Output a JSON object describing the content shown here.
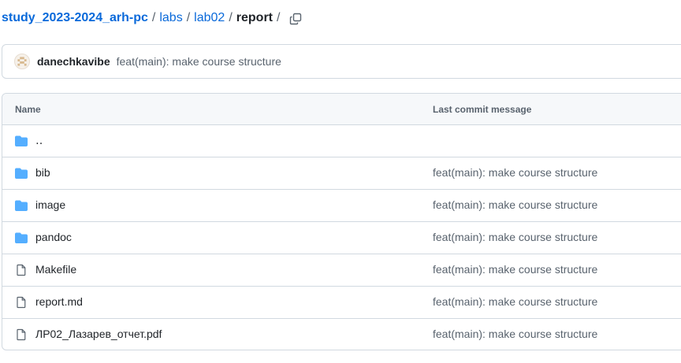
{
  "breadcrumb": {
    "repo": "study_2023-2024_arh-pc",
    "sep1": "/",
    "dir1": "labs",
    "sep2": "/",
    "dir2": "lab02",
    "sep3": "/",
    "current": "report",
    "sep4": "/",
    "copy_icon": "copy-icon"
  },
  "latest_commit": {
    "author": "danechkavibe",
    "message": "feat(main): make course structure",
    "avatar_icon": "identicon-avatar"
  },
  "table": {
    "col_name": "Name",
    "col_message": "Last commit message",
    "parent_row": {
      "name": "‥",
      "icon": "folder-icon"
    },
    "rows": [
      {
        "name": "bib",
        "message": "feat(main): make course structure",
        "icon": "folder-icon"
      },
      {
        "name": "image",
        "message": "feat(main): make course structure",
        "icon": "folder-icon"
      },
      {
        "name": "pandoc",
        "message": "feat(main): make course structure",
        "icon": "folder-icon"
      },
      {
        "name": "Makefile",
        "message": "feat(main): make course structure",
        "icon": "file-icon"
      },
      {
        "name": "report.md",
        "message": "feat(main): make course structure",
        "icon": "file-icon"
      },
      {
        "name": "ЛР02_Лазарев_отчет.pdf",
        "message": "feat(main): make course structure",
        "icon": "file-icon"
      }
    ]
  },
  "colors": {
    "link": "#0969da",
    "folder": "#54aeff",
    "muted": "#59636e",
    "border": "#d1d9e0",
    "header_bg": "#f6f8fa"
  }
}
